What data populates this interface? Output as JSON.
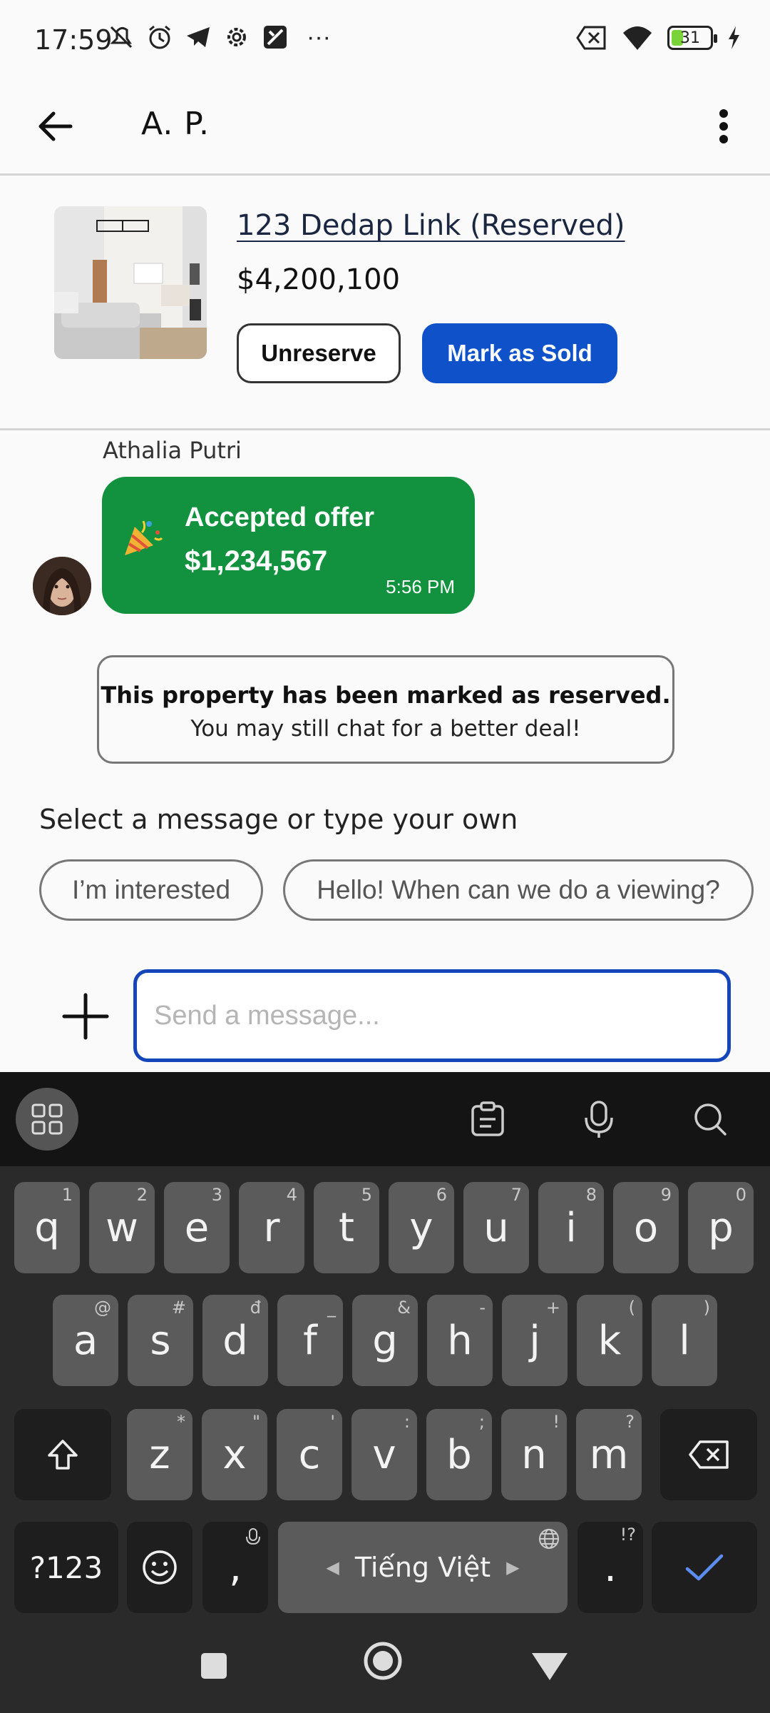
{
  "status_bar": {
    "time": "17:59",
    "battery_level": "31",
    "battery_fraction": 0.31,
    "more_indicator": "···"
  },
  "header": {
    "title": "A. P."
  },
  "listing": {
    "title": "123 Dedap Link (Reserved)",
    "price": "$4,200,100",
    "unreserve_label": "Unreserve",
    "mark_sold_label": "Mark as Sold"
  },
  "chat": {
    "sender_name": "Athalia Putri",
    "offer": {
      "label": "Accepted offer",
      "amount": "$1,234,567",
      "time": "5:56 PM"
    },
    "system_note": {
      "title": "This property has been marked as reserved.",
      "subtitle": "You may still chat for a better deal!"
    },
    "suggest_prompt": "Select a message or type your own",
    "suggestions": [
      "I’m interested",
      "Hello! When can we do a viewing?"
    ],
    "input_placeholder": "Send a message..."
  },
  "keyboard": {
    "row1": [
      {
        "k": "q",
        "h": "1"
      },
      {
        "k": "w",
        "h": "2"
      },
      {
        "k": "e",
        "h": "3"
      },
      {
        "k": "r",
        "h": "4"
      },
      {
        "k": "t",
        "h": "5"
      },
      {
        "k": "y",
        "h": "6"
      },
      {
        "k": "u",
        "h": "7"
      },
      {
        "k": "i",
        "h": "8"
      },
      {
        "k": "o",
        "h": "9"
      },
      {
        "k": "p",
        "h": "0"
      }
    ],
    "row2": [
      {
        "k": "a",
        "h": "@"
      },
      {
        "k": "s",
        "h": "#"
      },
      {
        "k": "d",
        "h": "đ"
      },
      {
        "k": "f",
        "h": "_"
      },
      {
        "k": "g",
        "h": "&"
      },
      {
        "k": "h",
        "h": "-"
      },
      {
        "k": "j",
        "h": "+"
      },
      {
        "k": "k",
        "h": "("
      },
      {
        "k": "l",
        "h": ")"
      }
    ],
    "row3": [
      {
        "k": "z",
        "h": "*"
      },
      {
        "k": "x",
        "h": "\""
      },
      {
        "k": "c",
        "h": "'"
      },
      {
        "k": "v",
        "h": ":"
      },
      {
        "k": "b",
        "h": ";"
      },
      {
        "k": "n",
        "h": "!"
      },
      {
        "k": "m",
        "h": "?"
      }
    ],
    "symbols_label": "?123",
    "comma_label": ",",
    "space_label": "Tiếng Việt",
    "period_label": ".",
    "period_hint": "!?"
  },
  "colors": {
    "primary_blue": "#0e51c9",
    "offer_green": "#12913f",
    "input_border": "#1546b9",
    "keyboard_bg": "#2a2a2a",
    "key_bg": "#5b5b5b",
    "check_blue": "#5b8df0"
  },
  "icons": {
    "status_left": [
      "mute-icon",
      "alarm-icon",
      "telegram-icon",
      "settings-gear-icon",
      "app-icon"
    ],
    "status_right": [
      "no-sim-icon",
      "wifi-icon",
      "battery-icon",
      "charging-icon"
    ],
    "header": [
      "back-arrow-icon",
      "more-vertical-icon"
    ],
    "keyboard_toolbar": [
      "apps-grid-icon",
      "clipboard-icon",
      "microphone-icon",
      "search-icon"
    ],
    "nav": [
      "recents-square-icon",
      "home-circle-icon",
      "back-triangle-icon"
    ]
  }
}
